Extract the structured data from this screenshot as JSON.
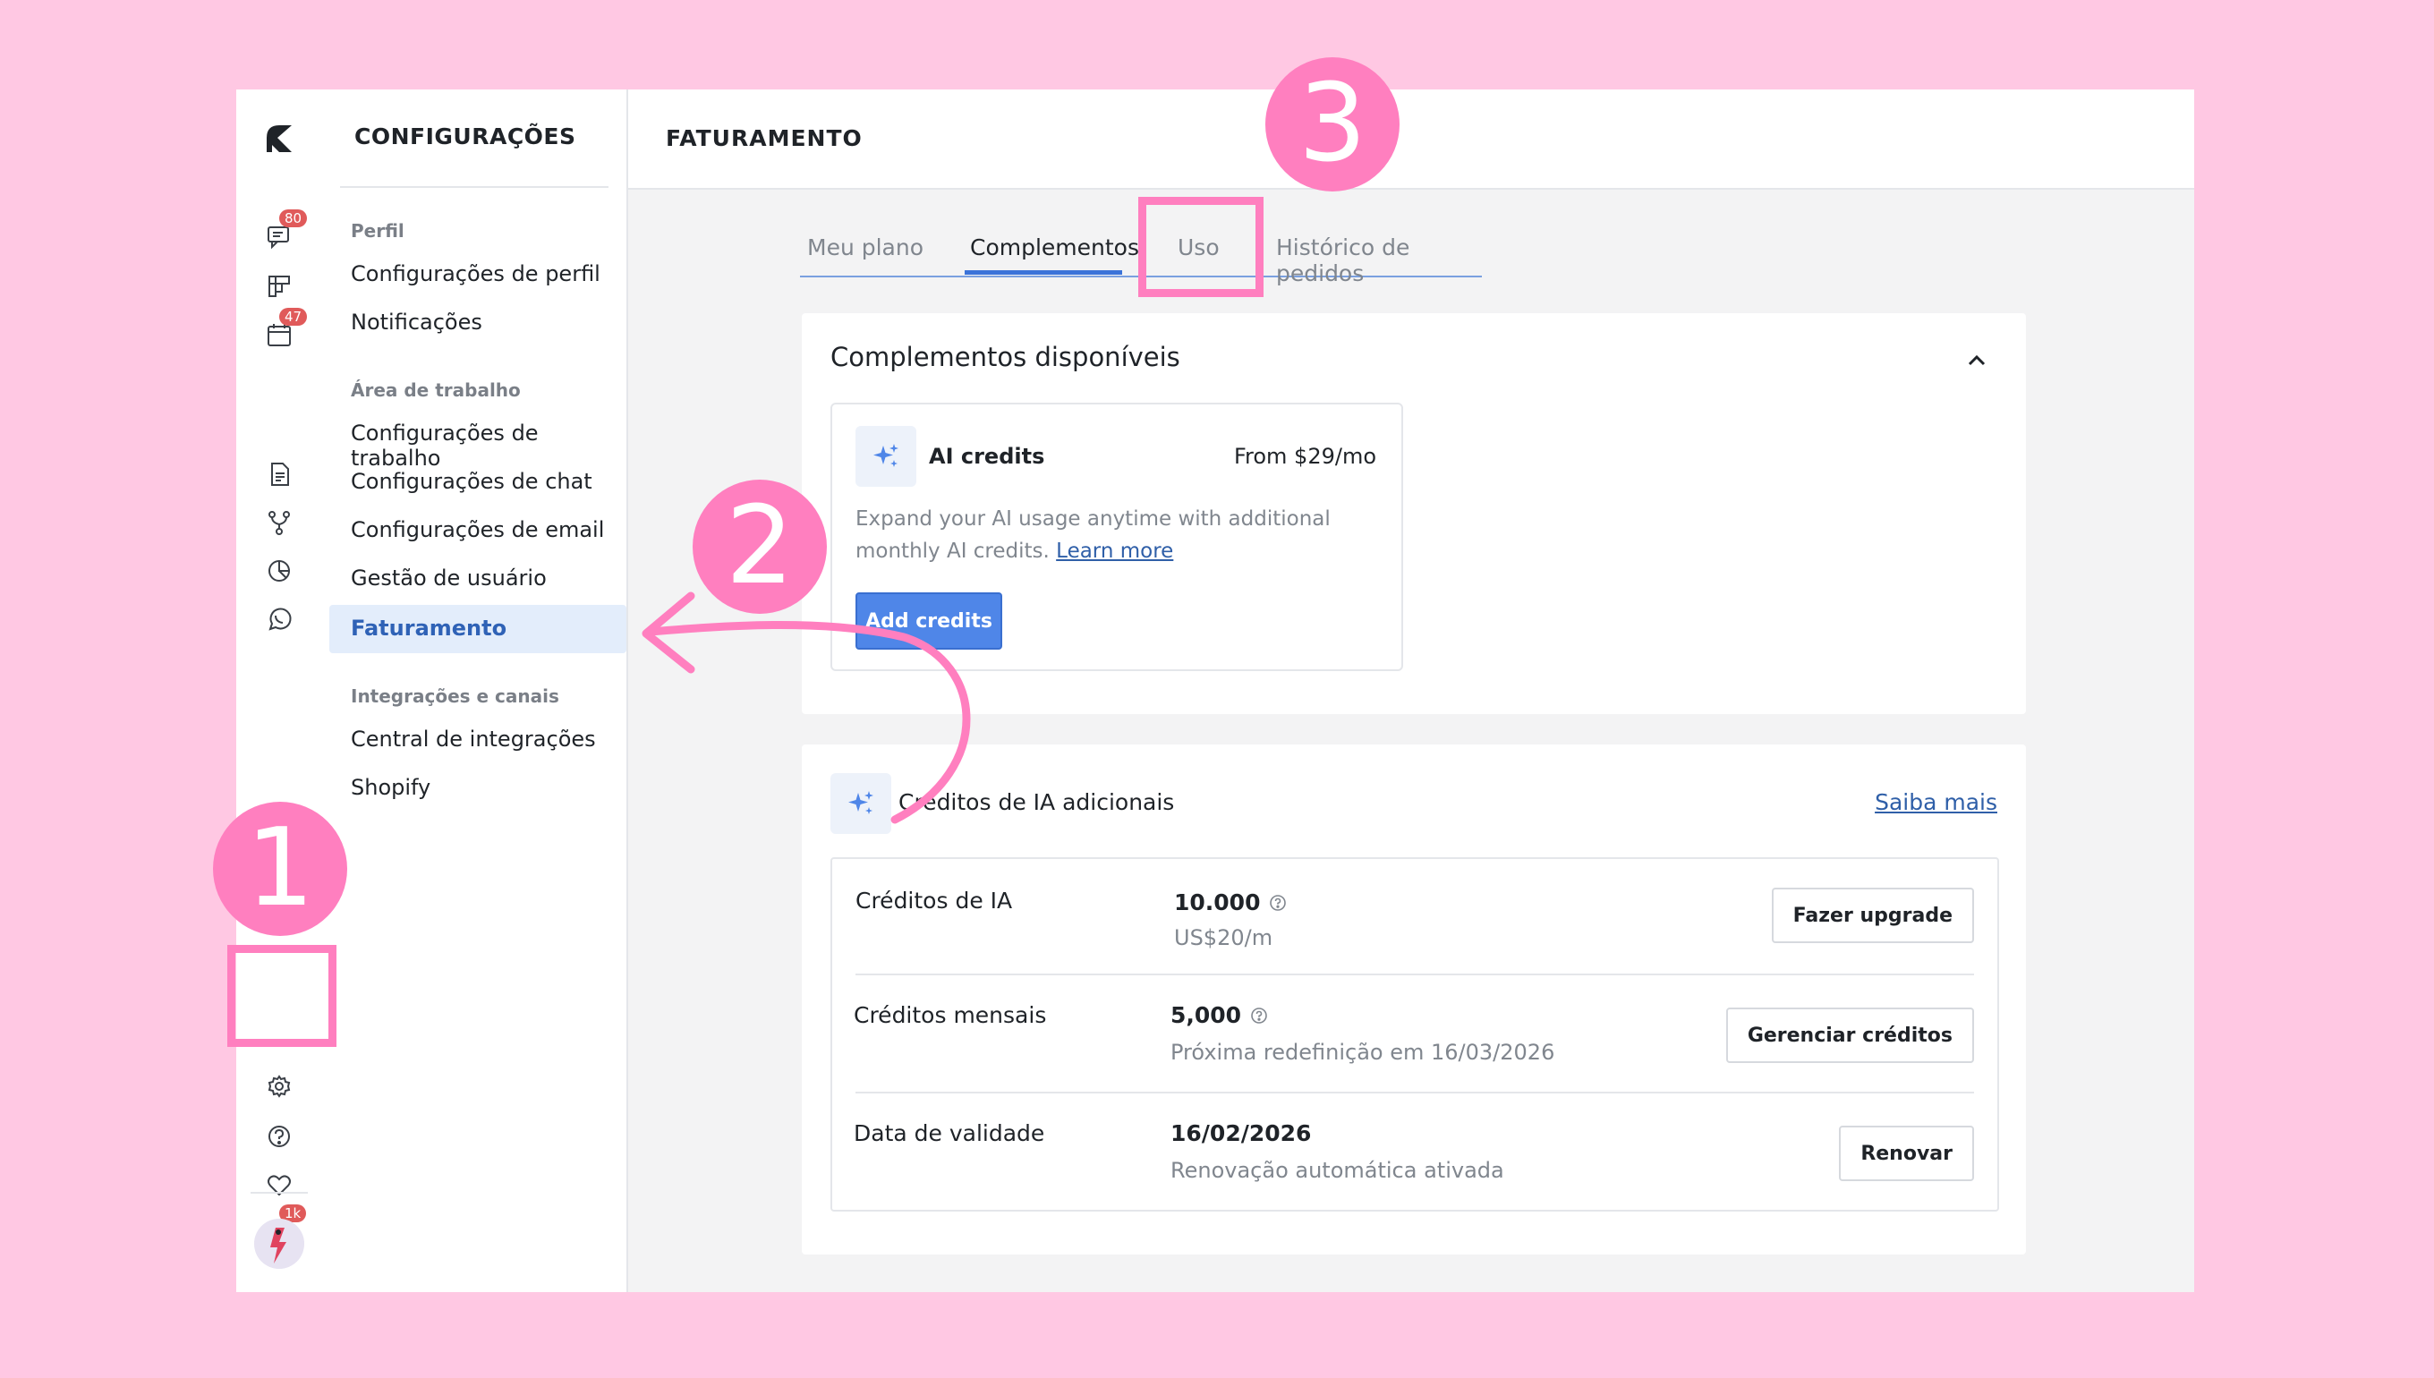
{
  "rail": {
    "badges": {
      "chat": "80",
      "calendar": "47",
      "notifications": "1k"
    },
    "icons": [
      "chat-icon",
      "board-icon",
      "calendar-icon",
      "document-icon",
      "workflow-icon",
      "report-icon",
      "whatsapp-icon",
      "settings-icon",
      "help-icon",
      "heart-icon",
      "bell-icon"
    ]
  },
  "menu": {
    "title": "CONFIGURAÇÕES",
    "sections": [
      {
        "label": "Perfil",
        "items": [
          "Configurações de perfil",
          "Notificações"
        ]
      },
      {
        "label": "Área de trabalho",
        "items": [
          "Configurações de trabalho",
          "Configurações de chat",
          "Configurações de email",
          "Gestão de usuário",
          "Faturamento"
        ]
      },
      {
        "label": "Integrações e canais",
        "items": [
          "Central de integrações",
          "Shopify"
        ]
      }
    ],
    "active_item": "Faturamento"
  },
  "header": {
    "title": "FATURAMENTO"
  },
  "tabs": [
    "Meu plano",
    "Complementos",
    "Uso",
    "Histórico de pedidos"
  ],
  "selected_tab": "Complementos",
  "addons_card": {
    "title": "Complementos disponíveis",
    "addon": {
      "name": "AI credits",
      "price": "From $29/mo",
      "description": "Expand your AI usage anytime with additional monthly AI credits.",
      "link": "Learn more",
      "button": "Add credits"
    }
  },
  "credits_card": {
    "title": "Créditos de IA adicionais",
    "link": "Saiba mais",
    "rows": [
      {
        "label": "Créditos de IA",
        "value": "10.000",
        "sub": "US$20/m",
        "button": "Fazer upgrade"
      },
      {
        "label": "Créditos mensais",
        "value": "5,000",
        "sub": "Próxima redefinição em 16/03/2026",
        "button": "Gerenciar créditos"
      },
      {
        "label": "Data de validade",
        "value": "16/02/2026",
        "sub": "Renovação automática ativada",
        "button": "Renovar"
      }
    ]
  },
  "annotations": [
    "1",
    "2",
    "3"
  ],
  "colors": {
    "background": "#ffc8e3",
    "annotation": "#ff7fbf",
    "primary": "#4f86e8",
    "active_menu_bg": "#e3edfb",
    "active_menu_text": "#2f62b6"
  }
}
